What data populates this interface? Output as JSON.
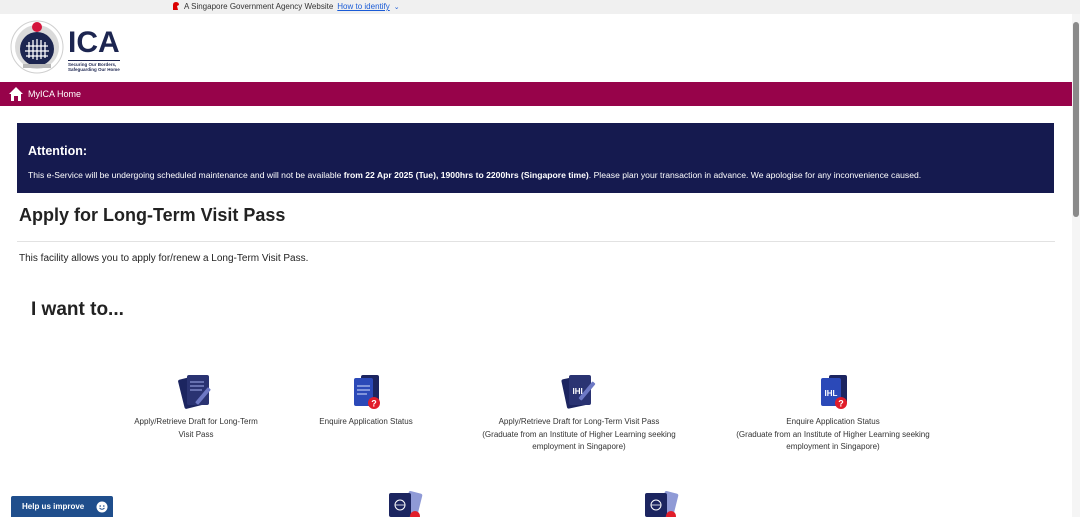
{
  "masthead": {
    "text": "A Singapore Government Agency Website",
    "link": "How to identify"
  },
  "logo": {
    "name": "ICA",
    "tagline_1": "Securing Our Borders,",
    "tagline_2": "Safeguarding Our Home"
  },
  "nav": {
    "home_label": "MyICA Home"
  },
  "attention": {
    "title": "Attention:",
    "text_before": "This e-Service will be undergoing scheduled maintenance and will not be available ",
    "text_bold": "from 22 Apr 2025 (Tue), 1900hrs to 2200hrs (Singapore time)",
    "text_after": ". Please plan your transaction in advance. We apologise for any inconvenience caused."
  },
  "page": {
    "title": "Apply for Long-Term Visit Pass",
    "description": "This facility allows you to apply for/renew a Long-Term Visit Pass.",
    "want_to": "I want to..."
  },
  "options": [
    {
      "line1": "Apply/Retrieve Draft for Long-Term",
      "line2": "Visit Pass",
      "line3": ""
    },
    {
      "line1": "Enquire Application Status",
      "line2": "",
      "line3": ""
    },
    {
      "line1": "Apply/Retrieve Draft for Long-Term Visit Pass",
      "line2": "(Graduate from an Institute of Higher Learning seeking",
      "line3": "employment in Singapore)"
    },
    {
      "line1": "Enquire Application Status",
      "line2": "(Graduate from an Institute of Higher Learning seeking",
      "line3": "employment in Singapore)"
    }
  ],
  "icon_labels": {
    "ihl": "IHL",
    "question": "?"
  },
  "help": {
    "label": "Help us improve"
  },
  "colors": {
    "nav_bar": "#97034a",
    "attention_bg": "#151a4f",
    "brand_navy": "#1c2550",
    "link": "#1a5bd6"
  }
}
